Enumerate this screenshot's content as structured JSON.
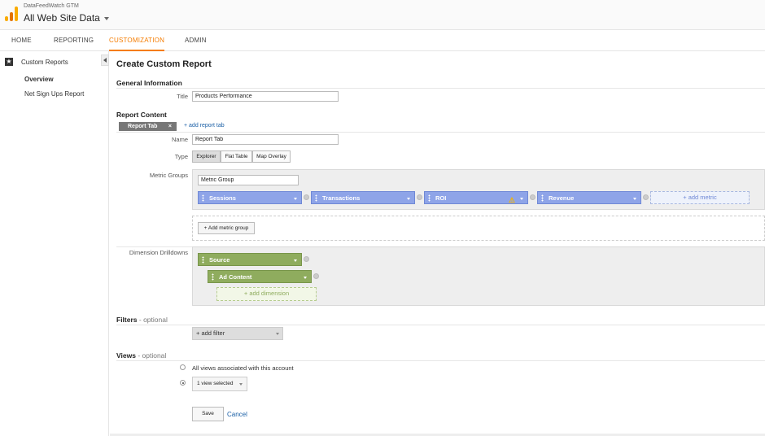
{
  "header": {
    "account": "DataFeedWatch GTM",
    "property": "All Web Site Data",
    "logo_colors": [
      "#f9ab00",
      "#e37400",
      "#f9ab00"
    ]
  },
  "nav": {
    "tabs": [
      {
        "label": "HOME",
        "active": false
      },
      {
        "label": "REPORTING",
        "active": false
      },
      {
        "label": "CUSTOMIZATION",
        "active": true
      },
      {
        "label": "ADMIN",
        "active": false
      }
    ],
    "accent": "#f57c00"
  },
  "sidebar": {
    "title": "Custom Reports",
    "icon": "star-icon",
    "items": [
      {
        "label": "Overview",
        "active": true
      },
      {
        "label": "Net Sign Ups Report",
        "active": false
      }
    ]
  },
  "form": {
    "page_title": "Create Custom Report",
    "general_info": {
      "heading": "General Information",
      "title_label": "Title",
      "title_value": "Products Performance"
    },
    "report_content": {
      "heading": "Report Content",
      "tab_label": "Report Tab",
      "tab_close": "×",
      "add_tab": "+ add report tab",
      "name_label": "Name",
      "name_value": "Report Tab",
      "type_label": "Type",
      "types": [
        {
          "label": "Explorer",
          "active": true
        },
        {
          "label": "Flat Table",
          "active": false
        },
        {
          "label": "Map Overlay",
          "active": false
        }
      ],
      "metric_groups_label": "Metric Groups",
      "metric_group_name": "Metric Group",
      "metrics": [
        {
          "label": "Sessions",
          "warning": false
        },
        {
          "label": "Transactions",
          "warning": false
        },
        {
          "label": "ROI",
          "warning": true
        },
        {
          "label": "Revenue",
          "warning": false
        }
      ],
      "add_metric": "+ add metric",
      "add_metric_group": "+ Add metric group",
      "dimension_label": "Dimension Drilldowns",
      "dimensions": [
        {
          "label": "Source"
        },
        {
          "label": "Ad Content"
        }
      ],
      "add_dimension": "+ add dimension",
      "metric_color": "#8ea4e8",
      "dimension_color": "#8fac5e"
    },
    "filters": {
      "heading": "Filters",
      "optional": " - optional",
      "add_filter": "+ add filter"
    },
    "views": {
      "heading": "Views",
      "optional": " - optional",
      "option_all": "All views associated with this account",
      "option_selected": "1 view selected",
      "selected_index": 1
    },
    "actions": {
      "save": "Save",
      "cancel": "Cancel"
    }
  }
}
